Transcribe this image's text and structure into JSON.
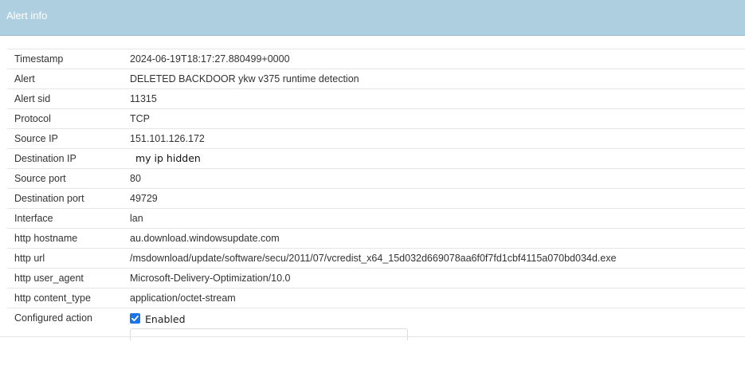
{
  "header": {
    "title": "Alert info"
  },
  "rows": [
    {
      "key": "Timestamp",
      "value": "2024-06-19T18:17:27.880499+0000"
    },
    {
      "key": "Alert",
      "value": "DELETED BACKDOOR ykw v375 runtime detection"
    },
    {
      "key": "Alert sid",
      "value": "11315"
    },
    {
      "key": "Protocol",
      "value": "TCP"
    },
    {
      "key": "Source IP",
      "value": "151.101.126.172"
    },
    {
      "key": "Destination IP",
      "value": "my ip hidden"
    },
    {
      "key": "Source port",
      "value": "80"
    },
    {
      "key": "Destination port",
      "value": "49729"
    },
    {
      "key": "Interface",
      "value": "lan"
    },
    {
      "key": "http hostname",
      "value": "au.download.windowsupdate.com"
    },
    {
      "key": "http url",
      "value": "/msdownload/update/software/secu/2011/07/vcredist_x64_15d032d669078aa6f0f7fd1cbf4115a070bd034d.exe"
    },
    {
      "key": "http user_agent",
      "value": "Microsoft-Delivery-Optimization/10.0"
    },
    {
      "key": "http content_type",
      "value": "application/octet-stream"
    }
  ],
  "configured_action": {
    "key": "Configured action",
    "checkbox_label": "Enabled",
    "checked": true
  },
  "colors": {
    "header_bg": "#aecfdf",
    "checkbox_accent": "#1a73e8"
  }
}
